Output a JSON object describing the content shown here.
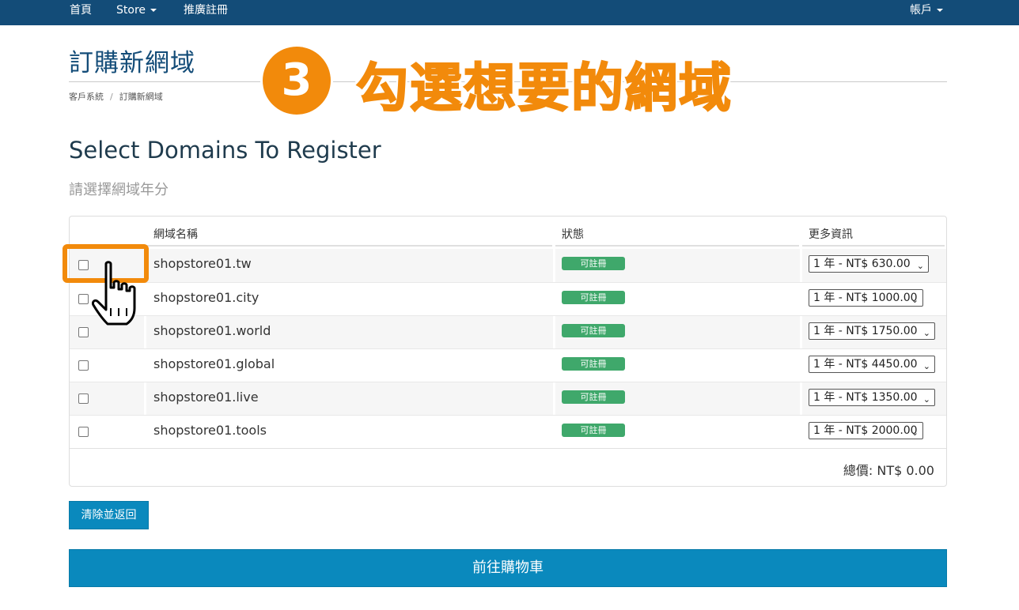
{
  "navbar": {
    "home": "首頁",
    "store": "Store",
    "affiliate": "推廣註冊",
    "account": "帳戶"
  },
  "header": {
    "title": "訂購新網域",
    "breadcrumb": [
      "客戶系統",
      "訂購新網域"
    ]
  },
  "annotation": {
    "step_number": "3",
    "step_text": "勾選想要的網域"
  },
  "main": {
    "heading": "Select Domains To Register",
    "subheading": "請選擇網域年分",
    "columns": [
      "網域名稱",
      "狀態",
      "更多資訊"
    ],
    "rows": [
      {
        "domain": "shopstore01.tw",
        "status": "可註冊",
        "option": "1 年 - NT$ 630.00"
      },
      {
        "domain": "shopstore01.city",
        "status": "可註冊",
        "option": "1 年 - NT$ 1000.00"
      },
      {
        "domain": "shopstore01.world",
        "status": "可註冊",
        "option": "1 年 - NT$ 1750.00"
      },
      {
        "domain": "shopstore01.global",
        "status": "可註冊",
        "option": "1 年 - NT$ 4450.00"
      },
      {
        "domain": "shopstore01.live",
        "status": "可註冊",
        "option": "1 年 - NT$ 1350.00"
      },
      {
        "domain": "shopstore01.tools",
        "status": "可註冊",
        "option": "1 年 - NT$ 2000.00"
      }
    ],
    "total": "總價: NT$ 0.00"
  },
  "buttons": {
    "clear": "清除並返回",
    "checkout": "前往購物車"
  },
  "colors": {
    "navbar": "#134c78",
    "accent_orange": "#f28a0b",
    "button_blue": "#0a89bd",
    "status_green": "#3fa86b"
  },
  "icons": {
    "pointer": "hand-pointer-icon",
    "dropdown": "caret-down-icon"
  }
}
